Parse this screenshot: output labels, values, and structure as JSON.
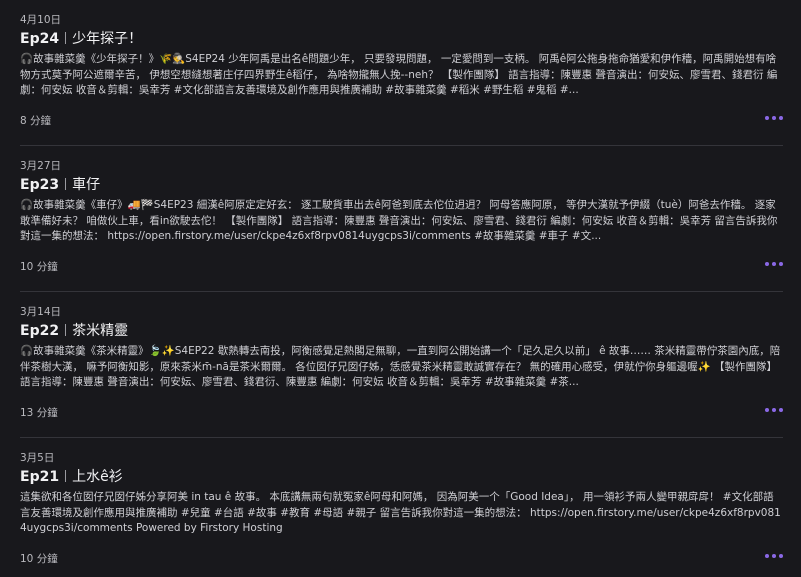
{
  "episodes": [
    {
      "date": "4月10日",
      "ep": "Ep24",
      "name": "少年探子！",
      "description": "🎧故事雜菜羹《少年探子！》🌾🕵️S4EP24 少年阿禹是出名ê問題少年， 只要發現問題， 一定愛問到一支柄。 阿禹ê阿公拖身拖命猶愛和伊作穡，阿禹開始想有啥物方式莫予阿公遮爾辛苦， 伊想空想縫想著庄仔四界野生ê稻仔， 為啥物攏無人挽--neh？ 【製作團隊】 語言指導：陳豐惠 聲音演出：何安妘、廖雪君、錢君衍 編劇：何安妘 收音＆剪輯：吳幸芳 #文化部語言友善環境及創作應用與推廣補助 #故事雜菜羹 #稻米 #野生稻 #鬼稻 #...",
      "duration": "8 分鐘"
    },
    {
      "date": "3月27日",
      "ep": "Ep23",
      "name": "車仔",
      "description": "🎧故事雜菜羹《車仔》🚚🏁S4EP23 細漢ê阿原定定好玄： 逐工駛貨車出去ê阿爸到底去佗位迌迌？ 阿母答應阿原， 等伊大漢就予伊綴（tuè）阿爸去作穡。 逐家敢準備好未？ 咱做伙上車，看in欲駛去佗！ 【製作團隊】 語言指導：陳豐惠 聲音演出：何安妘、廖雪君、錢君衍 編劇：何安妘 收音＆剪輯：吳幸芳 留言告訴我你對這一集的想法： https://open.firstory.me/user/ckpe4z6xf8rpv0814uygcps3i/comments #故事雜菜羹 #車子 #文...",
      "duration": "10 分鐘"
    },
    {
      "date": "3月14日",
      "ep": "Ep22",
      "name": "茶米精靈",
      "description": "🎧故事雜菜羹《茶米精靈》🍃✨S4EP22 歇熱轉去南投，阿衡感覺足熱閣足無聊，一直到阿公開始講一个「足久足久以前」 ê 故事…… 茶米精靈帶佇茶園內底，陪伴茶樹大漢， 嘛予阿衡知影，原來茶米m̄-nā是茶米爾爾。 各位囡仔兄囡仔姊，恁感覺茶米精靈敢誠實存在？ 無的確用心感受，伊就佇你身軀邊喔✨ 【製作團隊】 語言指導：陳豐惠 聲音演出：何安妘、廖雪君、錢君衍、陳豐惠 編劇：何安妘 收音＆剪輯：吳幸芳 #故事雜菜羹 #茶...",
      "duration": "13 分鐘"
    },
    {
      "date": "3月5日",
      "ep": "Ep21",
      "name": "上水ê衫",
      "description": "這集欲和各位囡仔兄囡仔姊分享阿美 in tau ê 故事。 本底講無兩句就冤家ê阿母和阿媽， 因為阿美一个「Good Idea」， 用一領衫予兩人變甲親戽戽！ #文化部語言友善環境及創作應用與推廣補助 #兒童 #台語 #故事 #教育 #母語 #親子 留言告訴我你對這一集的想法： https://open.firstory.me/user/ckpe4z6xf8rpv0814uygcps3i/comments Powered by Firstory Hosting",
      "duration": "10 分鐘"
    }
  ],
  "colors": {
    "background": "#18181c",
    "accent": "#8a68e6",
    "divider": "#34343a"
  },
  "icons": {
    "more": "more-options-icon"
  }
}
